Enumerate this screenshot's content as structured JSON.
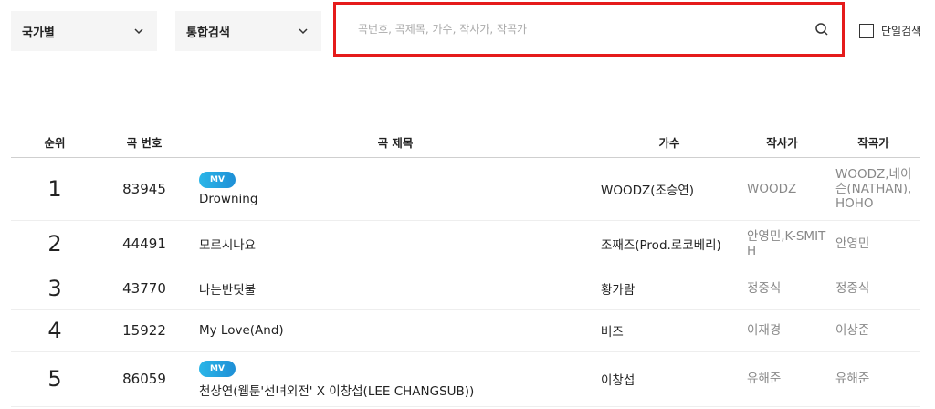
{
  "filters": {
    "country": {
      "value": "국가별"
    },
    "scope": {
      "value": "통합검색"
    }
  },
  "search": {
    "placeholder": "곡번호, 곡제목, 가수, 작사가, 작곡가",
    "value": ""
  },
  "single_search": {
    "label": "단일검색",
    "checked": false
  },
  "colors": {
    "highlight_border": "#e51b1b",
    "mv_badge": "#1e8fd6"
  },
  "table": {
    "headers": {
      "rank": "순위",
      "number": "곡 번호",
      "title": "곡 제목",
      "artist": "가수",
      "lyricist": "작사가",
      "composer": "작곡가"
    },
    "rows": [
      {
        "rank": "1",
        "number": "83945",
        "mv": "MV",
        "title": "Drowning",
        "artist": "WOODZ(조승연)",
        "lyricist": "WOODZ",
        "composer": "WOODZ,네이슨(NATHAN),HOHO"
      },
      {
        "rank": "2",
        "number": "44491",
        "mv": "",
        "title": "모르시나요",
        "artist": "조째즈(Prod.로코베리)",
        "lyricist": "안영민,K-SMITH",
        "composer": "안영민"
      },
      {
        "rank": "3",
        "number": "43770",
        "mv": "",
        "title": "나는반딧불",
        "artist": "황가람",
        "lyricist": "정중식",
        "composer": "정중식"
      },
      {
        "rank": "4",
        "number": "15922",
        "mv": "",
        "title": "My Love(And)",
        "artist": "버즈",
        "lyricist": "이재경",
        "composer": "이상준"
      },
      {
        "rank": "5",
        "number": "86059",
        "mv": "MV",
        "title": "천상연(웹툰'선녀외전' X 이창섭(LEE CHANGSUB))",
        "artist": "이창섭",
        "lyricist": "유해준",
        "composer": "유해준"
      }
    ]
  }
}
